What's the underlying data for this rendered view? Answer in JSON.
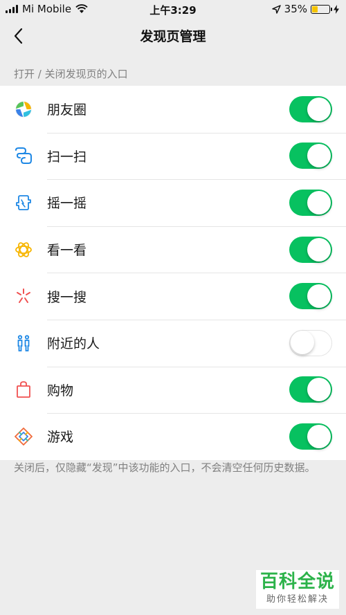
{
  "status_bar": {
    "carrier": "Mi Mobile",
    "time": "上午3:29",
    "battery_percent": "35%",
    "battery_level": 0.35,
    "battery_color": "#f5c400"
  },
  "nav": {
    "title": "发现页管理",
    "back_icon": "chevron-left-icon"
  },
  "section_header": "打开 / 关闭发现页的入口",
  "accent_color": "#07c160",
  "items": [
    {
      "label": "朋友圈",
      "icon": "moments-icon",
      "enabled": true
    },
    {
      "label": "扫一扫",
      "icon": "scan-icon",
      "enabled": true
    },
    {
      "label": "摇一摇",
      "icon": "shake-icon",
      "enabled": true
    },
    {
      "label": "看一看",
      "icon": "top-stories-icon",
      "enabled": true
    },
    {
      "label": "搜一搜",
      "icon": "search-icon",
      "enabled": true
    },
    {
      "label": "附近的人",
      "icon": "people-nearby-icon",
      "enabled": false
    },
    {
      "label": "购物",
      "icon": "shopping-bag-icon",
      "enabled": true
    },
    {
      "label": "游戏",
      "icon": "games-icon",
      "enabled": true
    }
  ],
  "footer_note": "关闭后，仅隐藏“发现”中该功能的入口，不会清空任何历史数据。",
  "watermark": {
    "title": "百科全说",
    "subtitle": "助你轻松解决"
  }
}
